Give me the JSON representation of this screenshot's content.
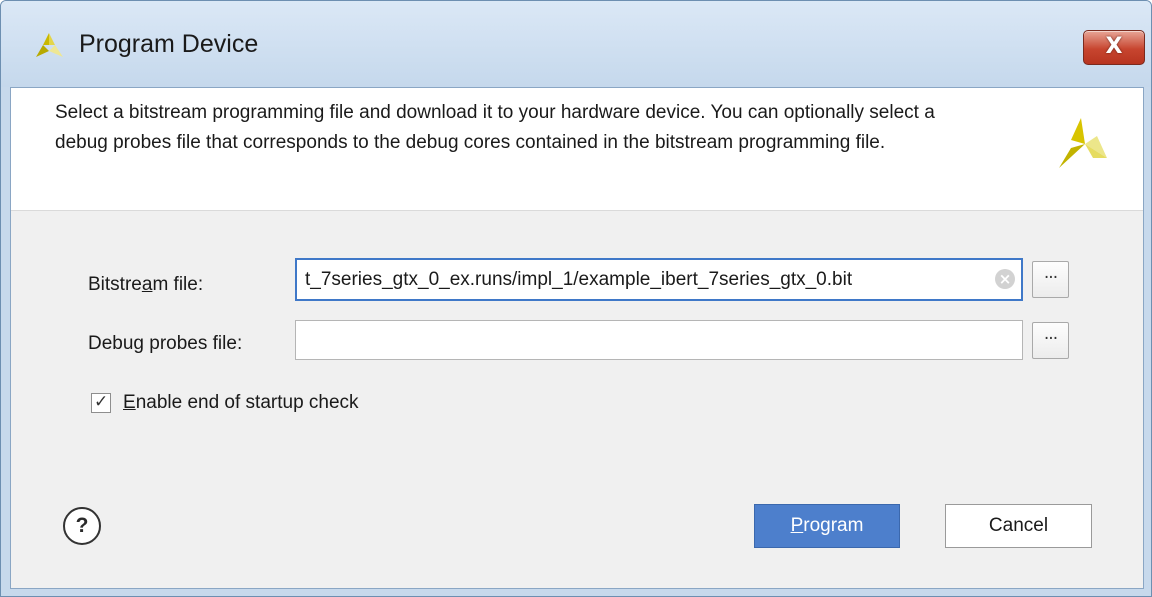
{
  "window": {
    "title": "Program Device",
    "close_label": "X"
  },
  "header": {
    "description": "Select a bitstream programming file and download it to your hardware device. You can optionally select a debug probes file that corresponds to the debug cores contained in the bitstream programming file."
  },
  "form": {
    "bitstream": {
      "label_pre": "Bitstre",
      "label_mnemonic": "a",
      "label_post": "m file:",
      "value": "t_7series_gtx_0_ex.runs/impl_1/example_ibert_7series_gtx_0.bit",
      "browse_label": "···"
    },
    "debug_probes": {
      "label_pre": "Debu",
      "label_mnemonic": "g",
      "label_post": " probes file:",
      "value": "",
      "browse_label": "···"
    },
    "startup_check": {
      "checked": true,
      "check_glyph": "✓",
      "label_mnemonic": "E",
      "label_post": "nable end of startup check"
    }
  },
  "footer": {
    "help_label": "?",
    "program_mnemonic": "P",
    "program_post": "rogram",
    "cancel_label": "Cancel"
  },
  "colors": {
    "titlebar": "#c7d9ec",
    "primary_button": "#4d7fcc",
    "focus_border": "#3f78c8",
    "close_button": "#c7452f",
    "logo_yellow": "#d8c400",
    "logo_light": "#ece68a"
  },
  "icons": {
    "title": "xilinx-logo-icon",
    "header": "xilinx-logo-icon",
    "close": "close-icon",
    "clear": "clear-circle-icon",
    "help": "help-icon",
    "check": "checkmark-icon"
  }
}
